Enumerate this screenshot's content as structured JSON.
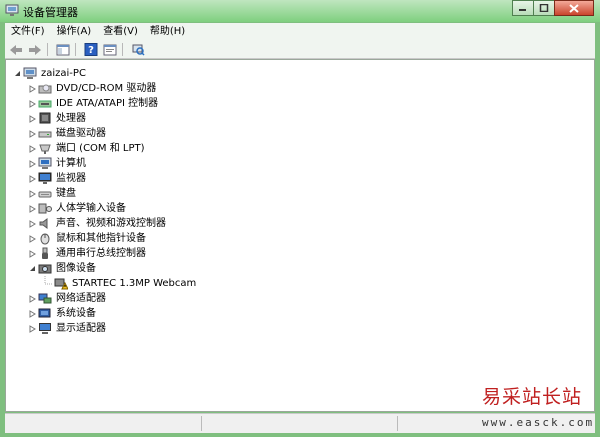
{
  "window": {
    "title": "设备管理器",
    "accent": "#7fcf7f"
  },
  "menu": [
    {
      "label": "文件(F)"
    },
    {
      "label": "操作(A)"
    },
    {
      "label": "查看(V)"
    },
    {
      "label": "帮助(H)"
    }
  ],
  "toolbar": {
    "icons": [
      "back-arrow-icon",
      "forward-arrow-icon",
      "show-hide-tree-icon",
      "help-icon",
      "properties-icon",
      "scan-hardware-icon"
    ]
  },
  "tree": {
    "root": "zaizai-PC",
    "items": [
      {
        "label": "DVD/CD-ROM 驱动器",
        "icon": "dvd-drive-icon"
      },
      {
        "label": "IDE ATA/ATAPI 控制器",
        "icon": "ide-controller-icon"
      },
      {
        "label": "处理器",
        "icon": "processor-icon"
      },
      {
        "label": "磁盘驱动器",
        "icon": "disk-drive-icon"
      },
      {
        "label": "端口 (COM 和 LPT)",
        "icon": "port-icon"
      },
      {
        "label": "计算机",
        "icon": "computer-icon"
      },
      {
        "label": "监视器",
        "icon": "monitor-icon"
      },
      {
        "label": "键盘",
        "icon": "keyboard-icon"
      },
      {
        "label": "人体学输入设备",
        "icon": "hid-icon"
      },
      {
        "label": "声音、视频和游戏控制器",
        "icon": "sound-icon"
      },
      {
        "label": "鼠标和其他指针设备",
        "icon": "mouse-icon"
      },
      {
        "label": "通用串行总线控制器",
        "icon": "usb-icon"
      },
      {
        "label": "图像设备",
        "icon": "imaging-device-icon",
        "expanded": true
      },
      {
        "label": "STARTEC 1.3MP Webcam",
        "icon": "webcam-warning-icon",
        "child": true
      },
      {
        "label": "网络适配器",
        "icon": "network-adapter-icon"
      },
      {
        "label": "系统设备",
        "icon": "system-device-icon"
      },
      {
        "label": "显示适配器",
        "icon": "display-adapter-icon"
      }
    ]
  },
  "watermark": {
    "name": "易采站长站",
    "url": "www.easck.com"
  }
}
